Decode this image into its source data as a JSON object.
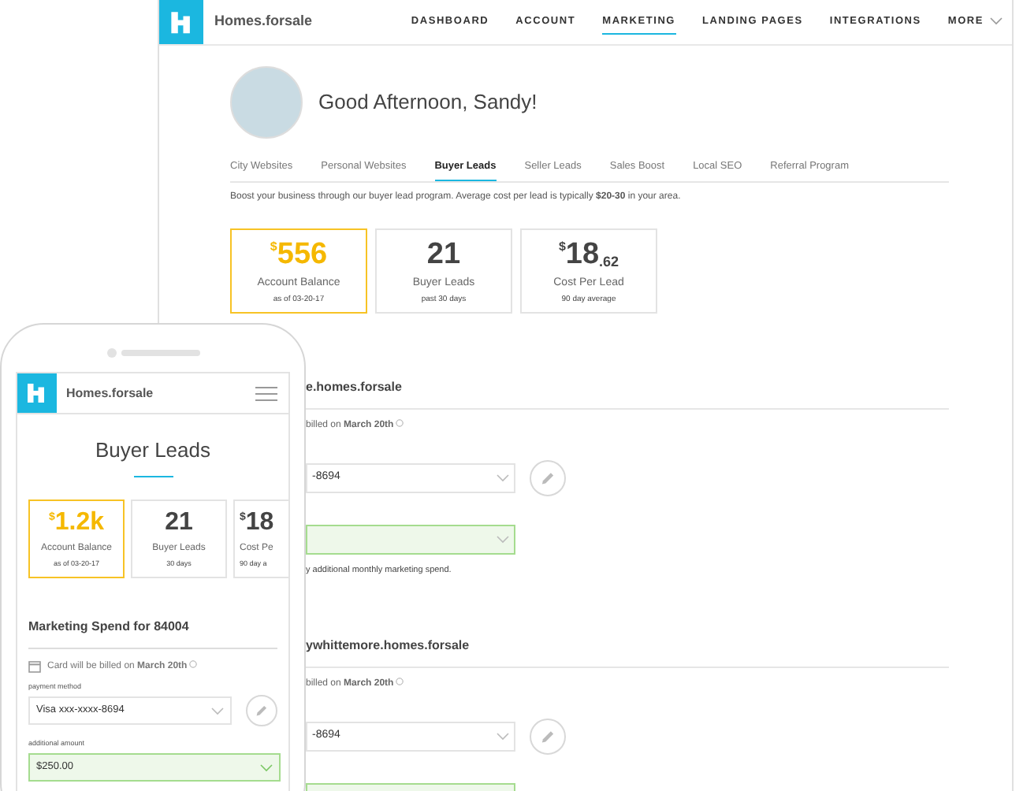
{
  "desktop": {
    "brand": "Homes.forsale",
    "nav": [
      {
        "label": "DASHBOARD",
        "selected": false,
        "dropdown": false
      },
      {
        "label": "ACCOUNT",
        "selected": false,
        "dropdown": false
      },
      {
        "label": "MARKETING",
        "selected": true,
        "dropdown": false
      },
      {
        "label": "LANDING PAGES",
        "selected": false,
        "dropdown": false
      },
      {
        "label": "INTEGRATIONS",
        "selected": false,
        "dropdown": false
      },
      {
        "label": "MORE",
        "selected": false,
        "dropdown": true
      }
    ],
    "greeting": "Good Afternoon, Sandy!",
    "tabs": [
      {
        "label": "City Websites",
        "selected": false
      },
      {
        "label": "Personal Websites",
        "selected": false
      },
      {
        "label": "Buyer Leads",
        "selected": true
      },
      {
        "label": "Seller Leads",
        "selected": false
      },
      {
        "label": "Sales Boost",
        "selected": false
      },
      {
        "label": "Local SEO",
        "selected": false
      },
      {
        "label": "Referral Program",
        "selected": false
      }
    ],
    "description": "Boost your business through our buyer lead program. Average cost per lead is typically **$20-30** in your area.",
    "stats": [
      {
        "currency": "$",
        "amount": "556",
        "label": "Account Balance",
        "note": "as of 03-20-17",
        "highlighted": true
      },
      {
        "amount": "21",
        "label": "Buyer Leads",
        "note": "past 30 days",
        "highlighted": false
      },
      {
        "currency": "$",
        "amount": "18",
        "fraction": ".62",
        "label": "Cost Per Lead",
        "note": "90 day average",
        "highlighted": false
      }
    ],
    "sites": [
      {
        "title": "e.homes.forsale",
        "billing": "billed on **March 20th**",
        "payment": "-8694",
        "note": "y additional monthly marketing spend."
      },
      {
        "title": "ywhittemore.homes.forsale",
        "billing": "billed on **March 20th**",
        "payment": "-8694"
      }
    ]
  },
  "phone": {
    "brand": "Homes.forsale",
    "title": "Buyer Leads",
    "stats": [
      {
        "currency": "$",
        "amount": "1.2k",
        "label": "Account Balance",
        "note": "as of 03-20-17",
        "highlighted": true
      },
      {
        "amount": "21",
        "label": "Buyer Leads",
        "note": "30 days",
        "highlighted": false
      },
      {
        "currency": "$",
        "amount": "18",
        "label": "Cost Pe",
        "note": "90 day a",
        "highlighted": false
      }
    ],
    "section_title": "Marketing Spend for 84004",
    "billing": "Card will be billed on **March 20th**",
    "payment_label": "payment method",
    "payment": "Visa xxx-xxxx-8694",
    "amount_label": "additional amount",
    "amount": "$250.00"
  }
}
